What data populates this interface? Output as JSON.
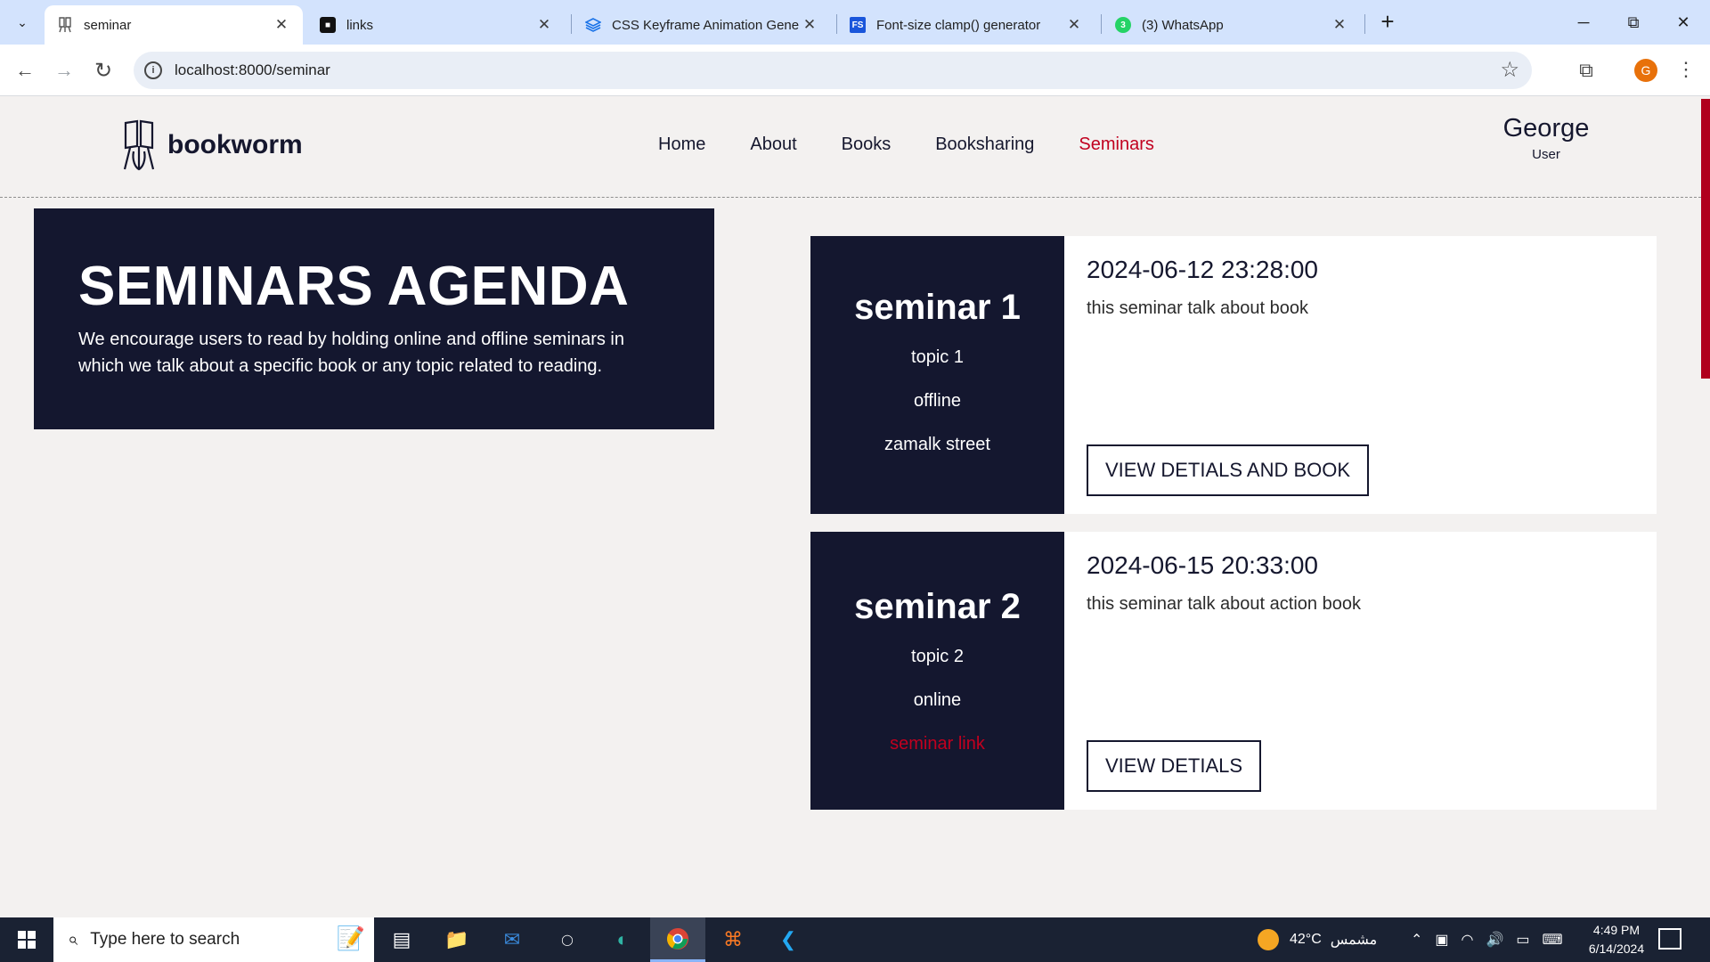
{
  "browser": {
    "tabs": [
      {
        "title": "seminar",
        "icon": "bookworm-favicon",
        "active": true
      },
      {
        "title": "links",
        "icon": "notion-icon",
        "active": false
      },
      {
        "title": "CSS Keyframe Animation Gene",
        "icon": "layers-icon",
        "active": false
      },
      {
        "title": "Font-size clamp() generator",
        "icon": "fs-icon",
        "fs_label": "FS",
        "active": false
      },
      {
        "title": "(3) WhatsApp",
        "icon": "whatsapp-icon",
        "badge": "3",
        "active": false
      }
    ],
    "url": "localhost:8000/seminar",
    "profile_initial": "G"
  },
  "site": {
    "logo_text": "bookworm",
    "nav": [
      "Home",
      "About",
      "Books",
      "Booksharing",
      "Seminars"
    ],
    "active_nav": "Seminars",
    "user": {
      "name": "George",
      "role": "User"
    }
  },
  "agenda": {
    "title": "SEMINARS AGENDA",
    "description": "We encourage users to read by holding online and offline seminars in which we talk about a specific book or any topic related to reading."
  },
  "seminars": [
    {
      "title": "seminar 1",
      "topic": "topic 1",
      "mode": "offline",
      "place": "zamalk street",
      "datetime": "2024-06-12 23:28:00",
      "description": "this seminar talk about book",
      "button": "VIEW DETIALS AND BOOK"
    },
    {
      "title": "seminar 2",
      "topic": "topic 2",
      "mode": "online",
      "place": "seminar link",
      "datetime": "2024-06-15 20:33:00",
      "description": "this seminar talk about action book",
      "button": "VIEW DETIALS"
    }
  ],
  "taskbar": {
    "search_placeholder": "Type here to search",
    "weather_temp": "42°C",
    "weather_text": "مشمس",
    "time": "4:49 PM",
    "date": "6/14/2024"
  },
  "colors": {
    "navy": "#14172f",
    "accent": "#c1001f",
    "page_bg": "#f3f1f0",
    "tabbar_bg": "#d3e3fd"
  }
}
